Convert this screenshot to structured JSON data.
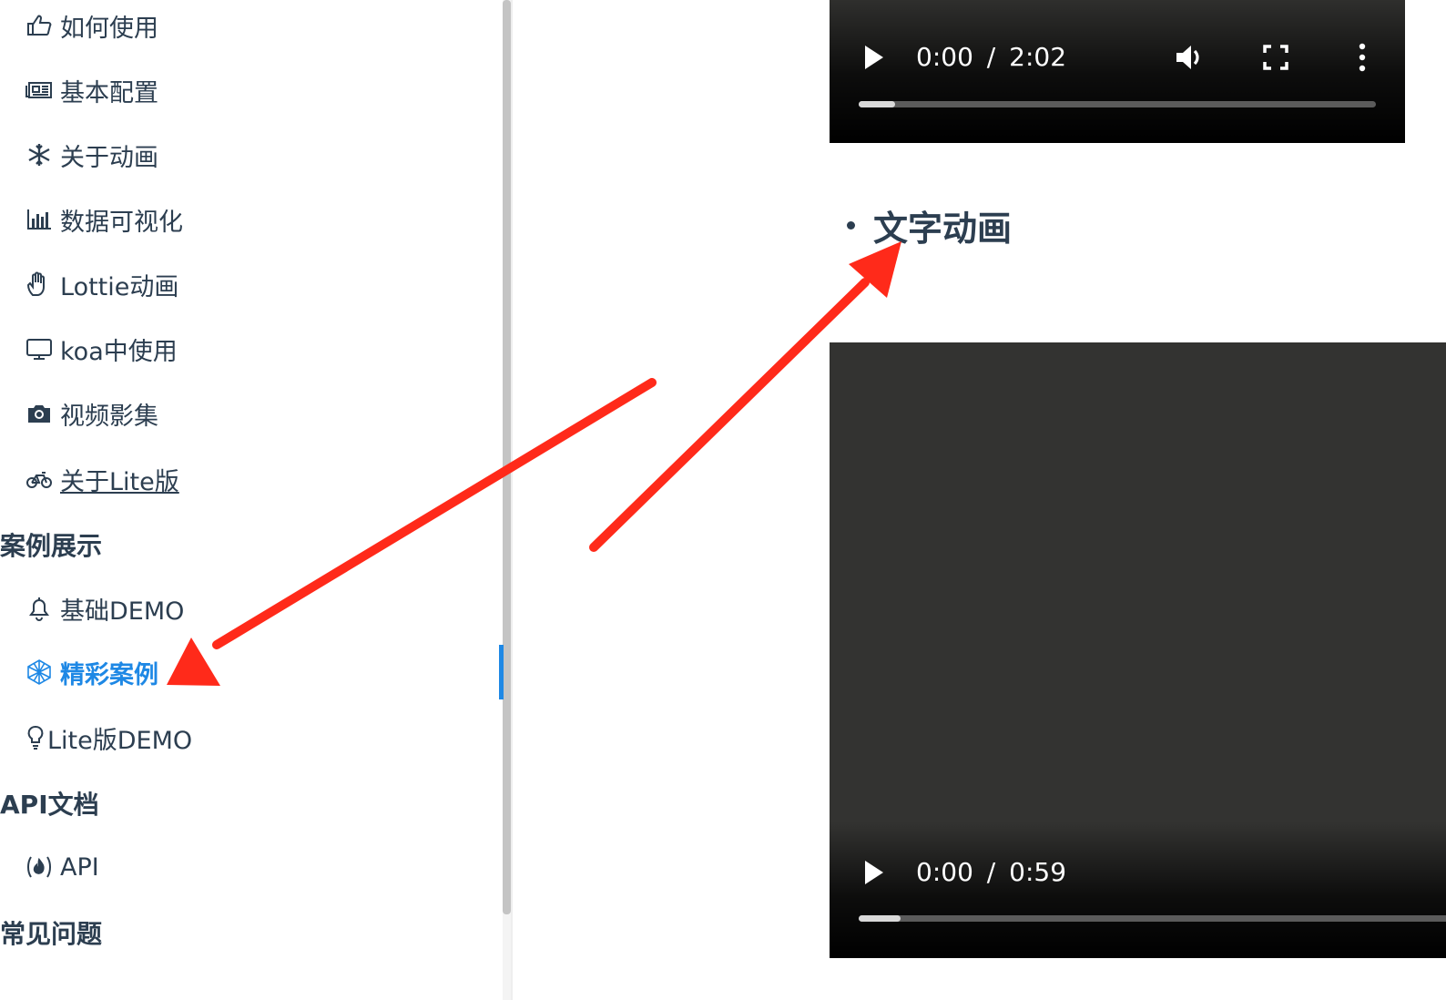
{
  "sidebar": {
    "items": [
      {
        "label": "如何使用",
        "icon": "pointing-hand-icon"
      },
      {
        "label": "基本配置",
        "icon": "newspaper-icon"
      },
      {
        "label": "关于动画",
        "icon": "snowflake-icon"
      },
      {
        "label": "数据可视化",
        "icon": "bar-chart-icon"
      },
      {
        "label": "Lottie动画",
        "icon": "hand-icon"
      },
      {
        "label": "koa中使用",
        "icon": "monitor-icon"
      },
      {
        "label": "视频影集",
        "icon": "camera-icon"
      },
      {
        "label": "关于Lite版",
        "icon": "bicycle-icon"
      }
    ],
    "sections": [
      {
        "title": "案例展示",
        "items": [
          {
            "label": "基础DEMO",
            "icon": "bell-icon"
          },
          {
            "label": "精彩案例",
            "icon": "gem-icon",
            "active": true
          },
          {
            "label": "Lite版DEMO",
            "icon": "lightbulb-icon"
          }
        ]
      },
      {
        "title": "API文档",
        "items": [
          {
            "label": "API",
            "icon": "api-fire-icon"
          }
        ]
      },
      {
        "title": "常见问题",
        "items": []
      }
    ]
  },
  "main": {
    "video1": {
      "time_current": "0:00",
      "time_separator": "/",
      "time_total": "2:02",
      "progress": 0.07
    },
    "heading": "文字动画",
    "video2": {
      "time_current": "0:00",
      "time_separator": "/",
      "time_total": "0:59",
      "progress": 0.07
    }
  },
  "colors": {
    "accent": "#1e88e5",
    "text": "#2c3e50",
    "arrow": "#ff2a1a",
    "video_bg": "#333331"
  }
}
